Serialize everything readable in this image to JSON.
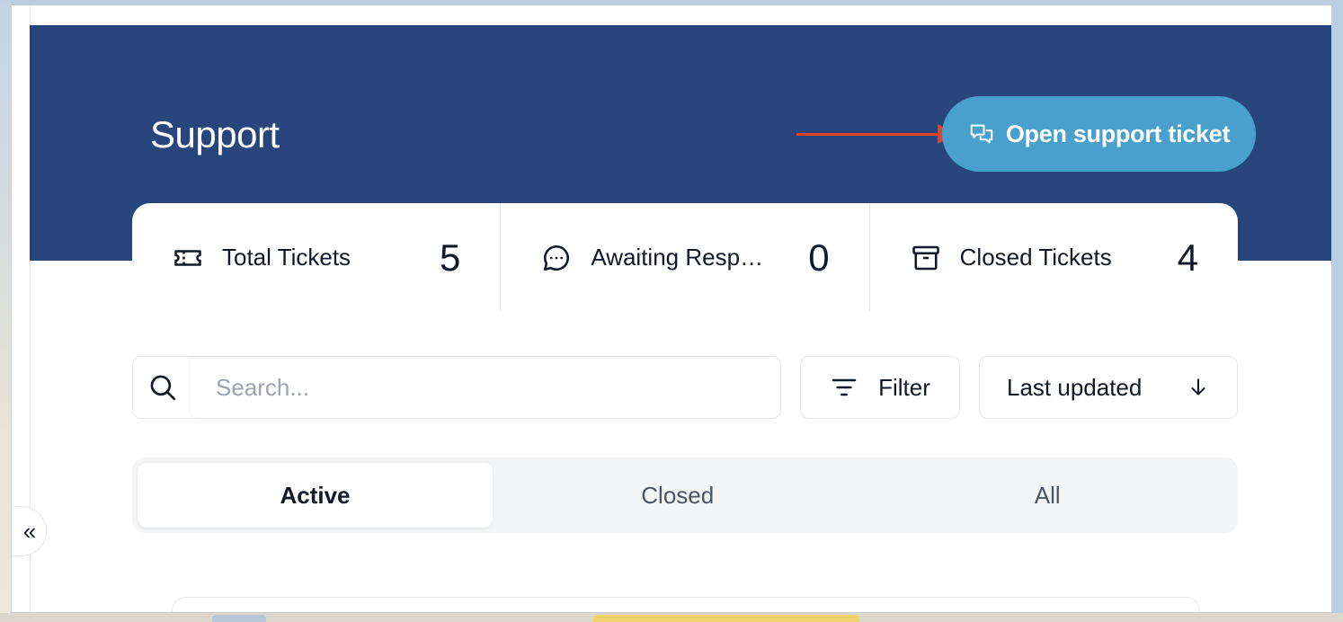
{
  "header": {
    "title": "Support",
    "open_ticket_label": "Open support ticket",
    "hero_color": "#28467d",
    "button_color": "#4aa0cc",
    "annotation_arrow_color": "#e0432a"
  },
  "stats": [
    {
      "icon": "ticket-icon",
      "label": "Total Tickets",
      "value": "5"
    },
    {
      "icon": "message-bubble-icon",
      "label": "Awaiting Response",
      "value": "0"
    },
    {
      "icon": "archive-box-icon",
      "label": "Closed Tickets",
      "value": "4"
    }
  ],
  "toolbar": {
    "search_placeholder": "Search...",
    "filter_label": "Filter",
    "sort_label": "Last updated"
  },
  "tabs": [
    {
      "label": "Active",
      "active": true
    },
    {
      "label": "Closed",
      "active": false
    },
    {
      "label": "All",
      "active": false
    }
  ],
  "sidebar": {
    "collapse_label": "«"
  }
}
